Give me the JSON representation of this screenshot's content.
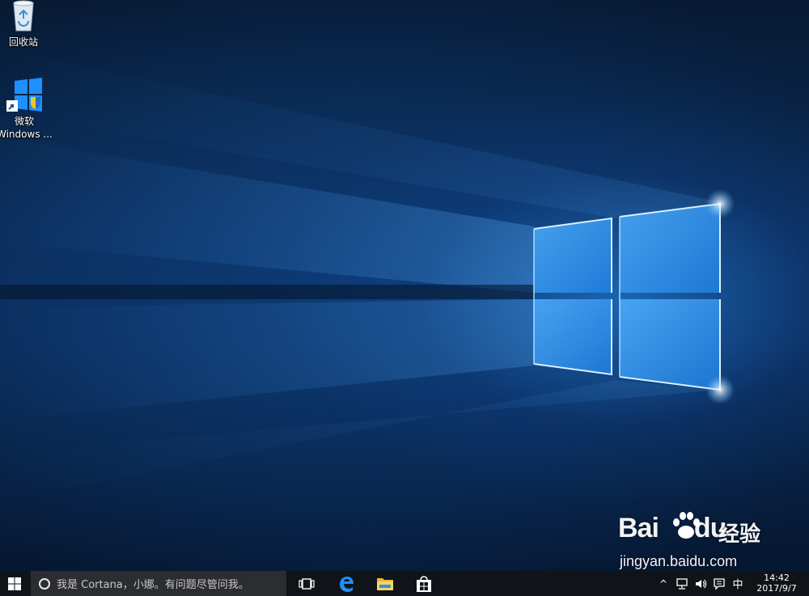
{
  "desktop": {
    "icons": [
      {
        "label": "回收站",
        "icon": "recycle-bin-icon"
      },
      {
        "label_line1": "微软",
        "label_line2": "Windows ...",
        "icon": "windows-shortcut-icon"
      }
    ]
  },
  "taskbar": {
    "start_icon": "windows-logo-icon",
    "search_placeholder": "我是 Cortana，小娜。有问题尽管问我。",
    "pinned": [
      {
        "icon": "task-view-icon"
      },
      {
        "icon": "edge-icon"
      },
      {
        "icon": "file-explorer-icon"
      },
      {
        "icon": "store-icon"
      }
    ],
    "tray": {
      "chevron": "^",
      "ime": "中",
      "time": "14:42",
      "date": "2017/9/7"
    }
  },
  "watermark": {
    "brand": "Bai",
    "brand_tail": "du",
    "brand_cn": "经验",
    "url": "jingyan.baidu.com"
  },
  "colors": {
    "wallpaper_dark": "#071a33",
    "wallpaper_light": "#2b8ce6",
    "taskbar": "#101418",
    "search_box": "#2b2d31",
    "accent": "#1e90ff"
  }
}
